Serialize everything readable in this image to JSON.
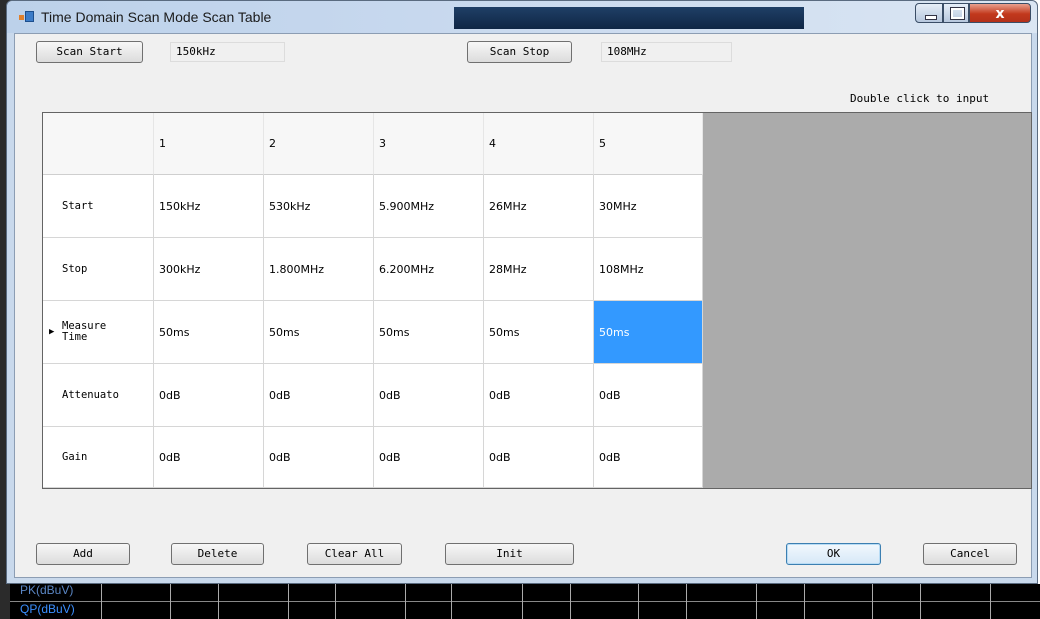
{
  "window": {
    "title": "Time Domain Scan Mode Scan Table",
    "close_glyph": "x"
  },
  "scan": {
    "start_label": "Scan Start",
    "start_value": "150kHz",
    "stop_label": "Scan Stop",
    "stop_value": "108MHz"
  },
  "hint": "Double click to input",
  "table": {
    "columns": [
      "1",
      "2",
      "3",
      "4",
      "5"
    ],
    "rows": [
      {
        "label": "Start",
        "values": [
          "150kHz",
          "530kHz",
          "5.900MHz",
          "26MHz",
          "30MHz"
        ]
      },
      {
        "label": "Stop",
        "values": [
          "300kHz",
          "1.800MHz",
          "6.200MHz",
          "28MHz",
          "108MHz"
        ]
      },
      {
        "label": "Measure Time",
        "values": [
          "50ms",
          "50ms",
          "50ms",
          "50ms",
          "50ms"
        ]
      },
      {
        "label": "Attenuato",
        "values": [
          "0dB",
          "0dB",
          "0dB",
          "0dB",
          "0dB"
        ]
      },
      {
        "label": "Gain",
        "values": [
          "0dB",
          "0dB",
          "0dB",
          "0dB",
          "0dB"
        ]
      }
    ],
    "current_row_marker": "▶",
    "selected_cell": {
      "row": 2,
      "col": 4
    },
    "selection_color": "#3399ff"
  },
  "buttons": {
    "add": "Add",
    "delete": "Delete",
    "clear_all": "Clear All",
    "init": "Init",
    "ok": "OK",
    "cancel": "Cancel"
  },
  "background_app": {
    "labels": [
      "PK(dBuV)",
      "QP(dBuV)"
    ],
    "label_color": "#3a8fff"
  }
}
